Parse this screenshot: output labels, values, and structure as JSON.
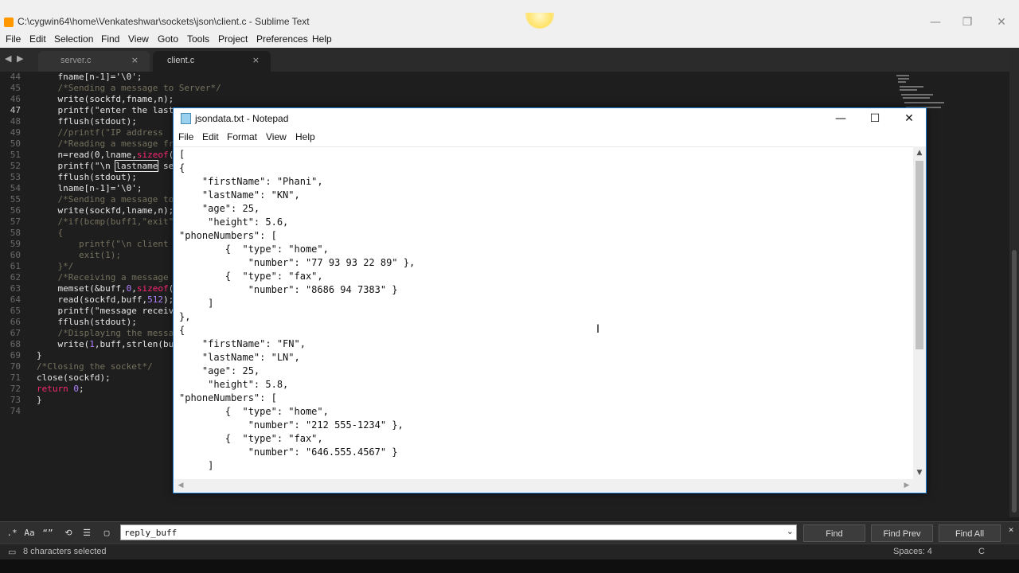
{
  "sublime": {
    "title": "C:\\cygwin64\\home\\Venkateshwar\\sockets\\json\\client.c - Sublime Text",
    "window_controls": {
      "minimize": "—",
      "maximize": "❐",
      "close": "✕"
    },
    "menu": [
      "File",
      "Edit",
      "Selection",
      "Find",
      "View",
      "Goto",
      "Tools",
      "Project",
      "Preferences",
      "Help"
    ],
    "tabs": [
      {
        "label": "server.c",
        "close": "×"
      },
      {
        "label": "client.c",
        "close": "×"
      }
    ],
    "nav": {
      "prev": "◀",
      "next": "▶"
    },
    "line_numbers": [
      "44",
      "45",
      "46",
      "47",
      "48",
      "49",
      "50",
      "51",
      "52",
      "53",
      "54",
      "55",
      "56",
      "57",
      "58",
      "59",
      "60",
      "61",
      "62",
      "63",
      "64",
      "65",
      "66",
      "67",
      "68",
      "69",
      "70",
      "71",
      "72",
      "73",
      "74"
    ],
    "code": {
      "l44": "    fname[n-1]='\\0';",
      "l45": "    /*Sending a message to Server*/",
      "l46": "    write(sockfd,fname,n);",
      "l47": "    printf(\"enter the last",
      "l48": "    fflush(stdout);",
      "l49": "    //printf(\"IP address",
      "l50": "    /*Reading a message fr",
      "l51_a": "    n=read(0,lname,",
      "l51_b": "sizeof",
      "l51_c": "(",
      "l52_a": "    printf(\"\\n ",
      "l52_b": "lastname",
      "l52_c": " se",
      "l53": "    fflush(stdout);",
      "l54": "    lname[n-1]='\\0';",
      "l55": "    /*Sending a message to",
      "l56": "    write(sockfd,lname,n);",
      "l57": "    /*if(bcmp(buff1,\"exit\"",
      "l58": "    {",
      "l59": "        printf(\"\\n client",
      "l60": "        exit(1);",
      "l61": "    }*/",
      "l62": "    /*Receiving a message",
      "l63_a": "    memset(&buff,",
      "l63_b": "0",
      "l63_c": ",",
      "l63_d": "sizeof",
      "l63_e": "(",
      "l64_a": "    read(sockfd,buff,",
      "l64_b": "512",
      "l64_c": ");",
      "l65": "    printf(\"message receiv",
      "l66": "    fflush(stdout);",
      "l67": "    /*Displaying the messa",
      "l68_a": "    write(",
      "l68_b": "1",
      "l68_c": ",buff,strlen(bu",
      "l69": "}",
      "l70": "/*Closing the socket*/",
      "l71": "close(sockfd);",
      "l72_a": "return",
      "l72_b": " 0",
      "l72_c": ";",
      "l73": "}",
      "l74": ""
    },
    "find_panel": {
      "opt_regex": ".*",
      "opt_case": "Aa",
      "opt_word": "“”",
      "opt_wrap": "⟲",
      "opt_insel": "☰",
      "opt_highlight": "▢",
      "query": "reply_buff",
      "dropdown": "⌄",
      "find": "Find",
      "find_prev": "Find Prev",
      "find_all": "Find All",
      "close": "×"
    },
    "status": {
      "selection": "8 characters selected",
      "indent": "Spaces: 4",
      "syntax": "C"
    }
  },
  "notepad": {
    "title": "jsondata.txt - Notepad",
    "window_controls": {
      "minimize": "—",
      "maximize": "☐",
      "close": "✕"
    },
    "menu": [
      "File",
      "Edit",
      "Format",
      "View",
      "Help"
    ],
    "lines": [
      "[",
      "{",
      "    \"firstName\": \"Phani\",",
      "    \"lastName\": \"KN\",",
      "    \"age\": 25,",
      "     \"height\": 5.6,",
      "\"phoneNumbers\": [",
      "        {  \"type\": \"home\",",
      "            \"number\": \"77 93 93 22 89\" },",
      "        {  \"type\": \"fax\",",
      "            \"number\": \"8686 94 7383\" }",
      "     ]",
      "},",
      "{",
      "    \"firstName\": \"FN\",",
      "    \"lastName\": \"LN\",",
      "    \"age\": 25,",
      "     \"height\": 5.8,",
      "\"phoneNumbers\": [",
      "        {  \"type\": \"home\",",
      "            \"number\": \"212 555-1234\" },",
      "        {  \"type\": \"fax\",",
      "            \"number\": \"646.555.4567\" }",
      "     ]"
    ],
    "scroll": {
      "up": "▲",
      "down": "▼",
      "left": "◀",
      "right": "▶"
    }
  },
  "cursor": "I"
}
